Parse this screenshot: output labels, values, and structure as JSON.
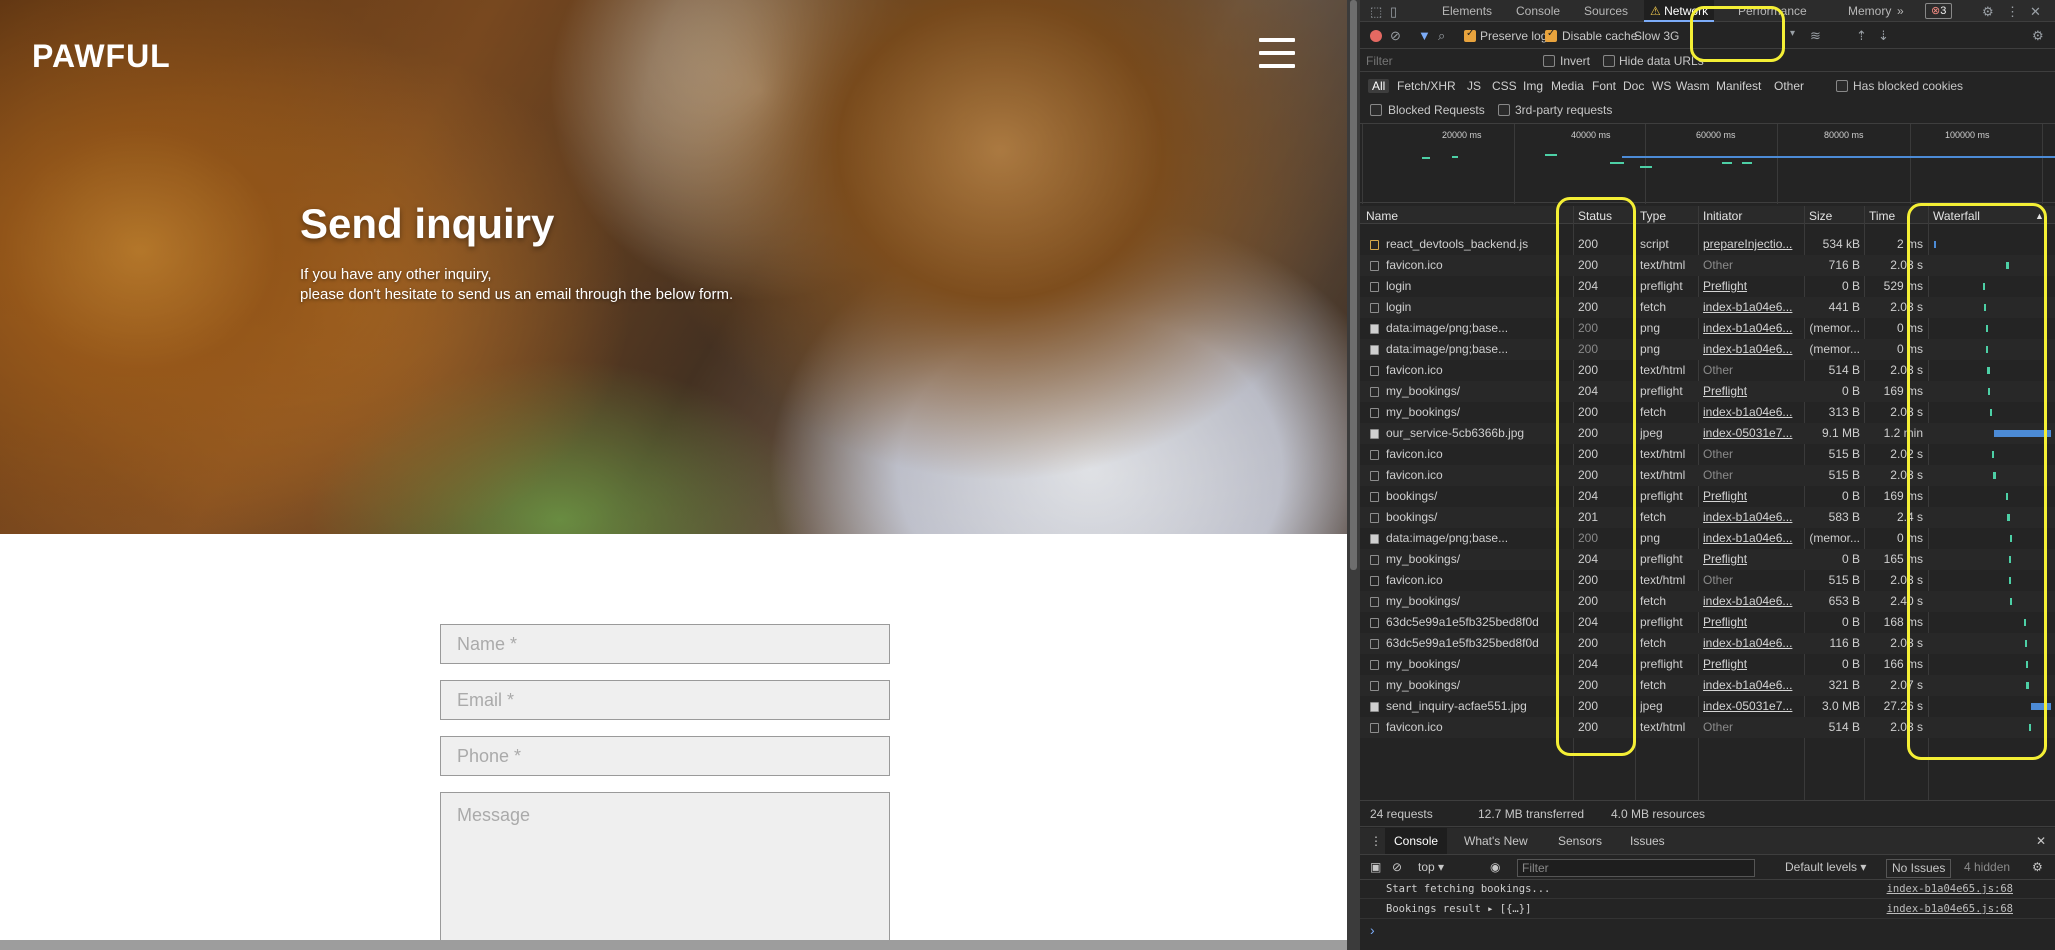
{
  "site": {
    "logo": "PAWFUL",
    "hero_title": "Send inquiry",
    "hero_line1": "If you have any other inquiry,",
    "hero_line2": "please don't hesitate to send us an email through the below form.",
    "name_placeholder": "Name *",
    "email_placeholder": "Email *",
    "phone_placeholder": "Phone *",
    "message_placeholder": "Message"
  },
  "devtools": {
    "tabs": [
      "Elements",
      "Console",
      "Sources",
      "Network",
      "Performance",
      "Memory"
    ],
    "more": "»",
    "error_count": "3",
    "toolbar": {
      "preserve_log": "Preserve log",
      "disable_cache": "Disable cache",
      "throttle": "Slow 3G",
      "preserve_checked": true,
      "disable_checked": true
    },
    "filter": {
      "placeholder": "Filter",
      "invert": "Invert",
      "hide_data_urls": "Hide data URLs",
      "types": [
        "All",
        "Fetch/XHR",
        "JS",
        "CSS",
        "Img",
        "Media",
        "Font",
        "Doc",
        "WS",
        "Wasm",
        "Manifest",
        "Other"
      ],
      "has_blocked_cookies": "Has blocked cookies",
      "blocked_requests": "Blocked Requests",
      "third_party": "3rd-party requests"
    },
    "overview_ticks": [
      "20000 ms",
      "40000 ms",
      "60000 ms",
      "80000 ms",
      "100000 ms"
    ],
    "columns": [
      "Name",
      "Status",
      "Type",
      "Initiator",
      "Size",
      "Time",
      "Waterfall"
    ],
    "requests": [
      {
        "name": "react_devtools_backend.js",
        "status": "200",
        "type": "script",
        "initiator": "prepareInjectio...",
        "size": "534 kB",
        "time": "2 ms",
        "icon": "js",
        "wf_start": 0.01,
        "wf_len": 0.01
      },
      {
        "name": "favicon.ico",
        "status": "200",
        "type": "text/html",
        "initiator": "Other",
        "size": "716 B",
        "time": "2.03 s",
        "icon": "doc",
        "wf_start": 0.62,
        "wf_len": 0.02
      },
      {
        "name": "login",
        "status": "204",
        "type": "preflight",
        "initiator": "Preflight",
        "size": "0 B",
        "time": "529 ms",
        "icon": "doc",
        "wf_start": 0.42,
        "wf_len": 0.01
      },
      {
        "name": "login",
        "status": "200",
        "type": "fetch",
        "initiator": "index-b1a04e6...",
        "size": "441 B",
        "time": "2.03 s",
        "icon": "doc",
        "wf_start": 0.43,
        "wf_len": 0.02
      },
      {
        "name": "data:image/png;base...",
        "status": "200",
        "type": "png",
        "initiator": "index-b1a04e6...",
        "size": "(memor...",
        "time": "0 ms",
        "icon": "img",
        "wf_start": 0.45,
        "wf_len": 0.01
      },
      {
        "name": "data:image/png;base...",
        "status": "200",
        "type": "png",
        "initiator": "index-b1a04e6...",
        "size": "(memor...",
        "time": "0 ms",
        "icon": "img",
        "wf_start": 0.45,
        "wf_len": 0.01
      },
      {
        "name": "favicon.ico",
        "status": "200",
        "type": "text/html",
        "initiator": "Other",
        "size": "514 B",
        "time": "2.03 s",
        "icon": "doc",
        "wf_start": 0.46,
        "wf_len": 0.02
      },
      {
        "name": "my_bookings/",
        "status": "204",
        "type": "preflight",
        "initiator": "Preflight",
        "size": "0 B",
        "time": "169 ms",
        "icon": "doc",
        "wf_start": 0.47,
        "wf_len": 0.01
      },
      {
        "name": "my_bookings/",
        "status": "200",
        "type": "fetch",
        "initiator": "index-b1a04e6...",
        "size": "313 B",
        "time": "2.03 s",
        "icon": "doc",
        "wf_start": 0.48,
        "wf_len": 0.02
      },
      {
        "name": "our_service-5cb6366b.jpg",
        "status": "200",
        "type": "jpeg",
        "initiator": "index-05031e7...",
        "size": "9.1 MB",
        "time": "1.2 min",
        "icon": "img",
        "wf_start": 0.52,
        "wf_len": 0.48
      },
      {
        "name": "favicon.ico",
        "status": "200",
        "type": "text/html",
        "initiator": "Other",
        "size": "515 B",
        "time": "2.02 s",
        "icon": "doc",
        "wf_start": 0.5,
        "wf_len": 0.02
      },
      {
        "name": "favicon.ico",
        "status": "200",
        "type": "text/html",
        "initiator": "Other",
        "size": "515 B",
        "time": "2.03 s",
        "icon": "doc",
        "wf_start": 0.51,
        "wf_len": 0.02
      },
      {
        "name": "bookings/",
        "status": "204",
        "type": "preflight",
        "initiator": "Preflight",
        "size": "0 B",
        "time": "169 ms",
        "icon": "doc",
        "wf_start": 0.62,
        "wf_len": 0.01
      },
      {
        "name": "bookings/",
        "status": "201",
        "type": "fetch",
        "initiator": "index-b1a04e6...",
        "size": "583 B",
        "time": "2.4 s",
        "icon": "doc",
        "wf_start": 0.63,
        "wf_len": 0.02
      },
      {
        "name": "data:image/png;base...",
        "status": "200",
        "type": "png",
        "initiator": "index-b1a04e6...",
        "size": "(memor...",
        "time": "0 ms",
        "icon": "img",
        "wf_start": 0.65,
        "wf_len": 0.01
      },
      {
        "name": "my_bookings/",
        "status": "204",
        "type": "preflight",
        "initiator": "Preflight",
        "size": "0 B",
        "time": "165 ms",
        "icon": "doc",
        "wf_start": 0.64,
        "wf_len": 0.01
      },
      {
        "name": "favicon.ico",
        "status": "200",
        "type": "text/html",
        "initiator": "Other",
        "size": "515 B",
        "time": "2.03 s",
        "icon": "doc",
        "wf_start": 0.64,
        "wf_len": 0.02
      },
      {
        "name": "my_bookings/",
        "status": "200",
        "type": "fetch",
        "initiator": "index-b1a04e6...",
        "size": "653 B",
        "time": "2.40 s",
        "icon": "doc",
        "wf_start": 0.65,
        "wf_len": 0.02
      },
      {
        "name": "63dc5e99a1e5fb325bed8f0d",
        "status": "204",
        "type": "preflight",
        "initiator": "Preflight",
        "size": "0 B",
        "time": "168 ms",
        "icon": "doc",
        "wf_start": 0.77,
        "wf_len": 0.01
      },
      {
        "name": "63dc5e99a1e5fb325bed8f0d",
        "status": "200",
        "type": "fetch",
        "initiator": "index-b1a04e6...",
        "size": "116 B",
        "time": "2.03 s",
        "icon": "doc",
        "wf_start": 0.78,
        "wf_len": 0.02
      },
      {
        "name": "my_bookings/",
        "status": "204",
        "type": "preflight",
        "initiator": "Preflight",
        "size": "0 B",
        "time": "166 ms",
        "icon": "doc",
        "wf_start": 0.79,
        "wf_len": 0.01
      },
      {
        "name": "my_bookings/",
        "status": "200",
        "type": "fetch",
        "initiator": "index-b1a04e6...",
        "size": "321 B",
        "time": "2.07 s",
        "icon": "doc",
        "wf_start": 0.79,
        "wf_len": 0.02
      },
      {
        "name": "send_inquiry-acfae551.jpg",
        "status": "200",
        "type": "jpeg",
        "initiator": "index-05031e7...",
        "size": "3.0 MB",
        "time": "27.26 s",
        "icon": "img",
        "wf_start": 0.83,
        "wf_len": 0.17
      },
      {
        "name": "favicon.ico",
        "status": "200",
        "type": "text/html",
        "initiator": "Other",
        "size": "514 B",
        "time": "2.03 s",
        "icon": "doc",
        "wf_start": 0.81,
        "wf_len": 0.02
      }
    ],
    "summary": {
      "requests": "24 requests",
      "transferred": "12.7 MB transferred",
      "resources": "4.0 MB resources"
    },
    "drawer_tabs": [
      "Console",
      "What's New",
      "Sensors",
      "Issues"
    ],
    "console_toolbar": {
      "context": "top",
      "filter_placeholder": "Filter",
      "levels": "Default levels",
      "issues": "No Issues",
      "hidden": "4 hidden"
    },
    "console_lines": [
      {
        "text": "Start fetching bookings...",
        "source": "index-b1a04e65.js:68"
      },
      {
        "text": "Bookings result ▸ [{…}]",
        "source": "index-b1a04e65.js:68"
      }
    ],
    "prompt": "›"
  }
}
